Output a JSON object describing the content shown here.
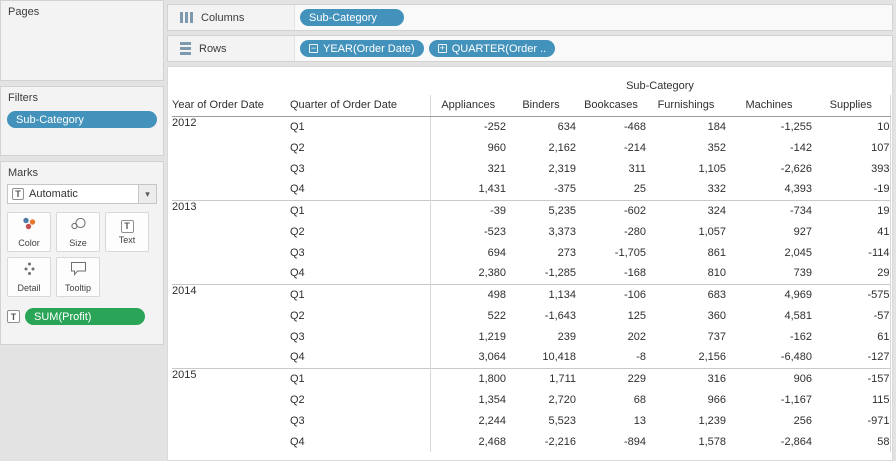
{
  "sidebar": {
    "pages": {
      "title": "Pages"
    },
    "filters": {
      "title": "Filters",
      "pills": [
        {
          "label": "Sub-Category"
        }
      ]
    },
    "marks": {
      "title": "Marks",
      "mark_type": {
        "icon": "T",
        "label": "Automatic"
      },
      "dropdown_arrow": "▾",
      "buttons": [
        {
          "label": "Color"
        },
        {
          "label": "Size"
        },
        {
          "label": "Text"
        },
        {
          "label": "Detail"
        },
        {
          "label": "Tooltip"
        }
      ],
      "pills": [
        {
          "icon": "T",
          "label": "SUM(Profit)"
        }
      ]
    }
  },
  "shelves": {
    "columns": {
      "label": "Columns",
      "pills": [
        {
          "label": "Sub-Category"
        }
      ]
    },
    "rows": {
      "label": "Rows",
      "pills": [
        {
          "toggle": "−",
          "label": "YEAR(Order Date)"
        },
        {
          "toggle": "+",
          "label": "QUARTER(Order .."
        }
      ]
    }
  },
  "table": {
    "column_field_title": "Sub-Category",
    "row_field_labels": [
      "Year of Order Date",
      "Quarter of Order Date"
    ],
    "measure_columns": [
      "Appliances",
      "Binders",
      "Bookcases",
      "Furnishings",
      "Machines",
      "Supplies"
    ],
    "groups": [
      {
        "year": "2012",
        "rows": [
          {
            "quarter": "Q1",
            "values": [
              "-252",
              "634",
              "-468",
              "184",
              "-1,255",
              "10"
            ]
          },
          {
            "quarter": "Q2",
            "values": [
              "960",
              "2,162",
              "-214",
              "352",
              "-142",
              "107"
            ]
          },
          {
            "quarter": "Q3",
            "values": [
              "321",
              "2,319",
              "311",
              "1,105",
              "-2,626",
              "393"
            ]
          },
          {
            "quarter": "Q4",
            "values": [
              "1,431",
              "-375",
              "25",
              "332",
              "4,393",
              "-19"
            ]
          }
        ]
      },
      {
        "year": "2013",
        "rows": [
          {
            "quarter": "Q1",
            "values": [
              "-39",
              "5,235",
              "-602",
              "324",
              "-734",
              "19"
            ]
          },
          {
            "quarter": "Q2",
            "values": [
              "-523",
              "3,373",
              "-280",
              "1,057",
              "927",
              "41"
            ]
          },
          {
            "quarter": "Q3",
            "values": [
              "694",
              "273",
              "-1,705",
              "861",
              "2,045",
              "-114"
            ]
          },
          {
            "quarter": "Q4",
            "values": [
              "2,380",
              "-1,285",
              "-168",
              "810",
              "739",
              "29"
            ]
          }
        ]
      },
      {
        "year": "2014",
        "rows": [
          {
            "quarter": "Q1",
            "values": [
              "498",
              "1,134",
              "-106",
              "683",
              "4,969",
              "-575"
            ]
          },
          {
            "quarter": "Q2",
            "values": [
              "522",
              "-1,643",
              "125",
              "360",
              "4,581",
              "-57"
            ]
          },
          {
            "quarter": "Q3",
            "values": [
              "1,219",
              "239",
              "202",
              "737",
              "-162",
              "61"
            ]
          },
          {
            "quarter": "Q4",
            "values": [
              "3,064",
              "10,418",
              "-8",
              "2,156",
              "-6,480",
              "-127"
            ]
          }
        ]
      },
      {
        "year": "2015",
        "rows": [
          {
            "quarter": "Q1",
            "values": [
              "1,800",
              "1,711",
              "229",
              "316",
              "906",
              "-157"
            ]
          },
          {
            "quarter": "Q2",
            "values": [
              "1,354",
              "2,720",
              "68",
              "966",
              "-1,167",
              "115"
            ]
          },
          {
            "quarter": "Q3",
            "values": [
              "2,244",
              "5,523",
              "13",
              "1,239",
              "256",
              "-971"
            ]
          },
          {
            "quarter": "Q4",
            "values": [
              "2,468",
              "-2,216",
              "-894",
              "1,578",
              "-2,864",
              "58"
            ]
          }
        ]
      }
    ]
  },
  "colors": {
    "pill_blue": "#4392bc",
    "pill_green": "#2aa558"
  }
}
